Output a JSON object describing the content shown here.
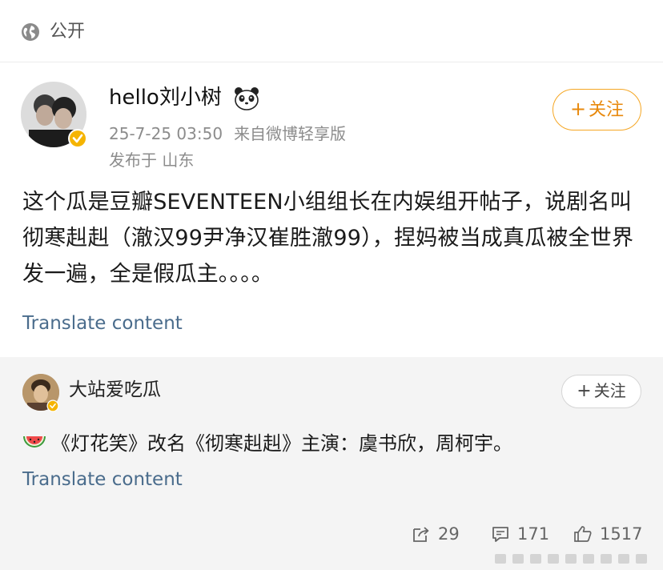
{
  "visibility": {
    "label": "公开",
    "icon": "globe-icon"
  },
  "post": {
    "username": "hello刘小树",
    "time": "25-7-25 03:50",
    "source": "来自微博轻享版",
    "location": "发布于 山东",
    "follow_label": "关注",
    "content": "这个瓜是豆瓣SEVENTEEN小组组长在内娱组开帖子，说剧名叫彻寒赳赳（澈汉99尹净汉崔胜澈99），捏妈被当成真瓜被全世界发一遍，全是假瓜主。。。。",
    "translate_label": "Translate content"
  },
  "repost": {
    "username": "大站爱吃瓜",
    "follow_label": "关注",
    "content": "《灯花笑》改名《彻寒赳赳》主演：虞书欣，周柯宇。",
    "translate_label": "Translate content",
    "stats": {
      "shares": "29",
      "comments": "171",
      "likes": "1517"
    }
  },
  "colors": {
    "follow_accent": "#f5a623",
    "link": "#4a6c8c",
    "verify_badge": "#f5b400",
    "repost_bg": "#f4f4f4"
  }
}
